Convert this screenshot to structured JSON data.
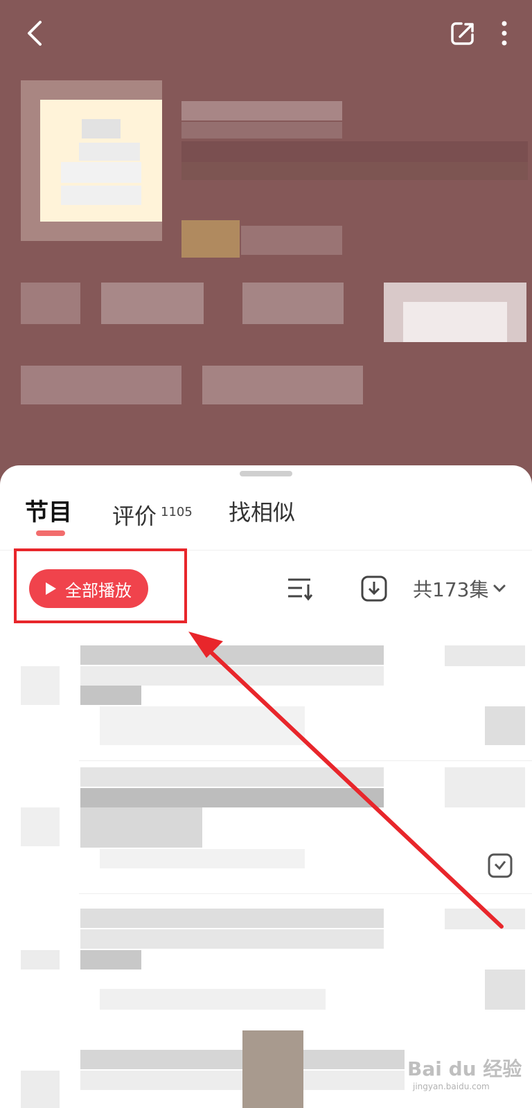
{
  "colors": {
    "header_bg": "#855858",
    "accent_red": "#f0434c",
    "tab_indicator": "#f26d6d",
    "highlight_border": "#e8262b"
  },
  "header": {
    "back_icon": "chevron-left-icon",
    "share_icon": "share-icon",
    "more_icon": "more-vertical-icon"
  },
  "tabs": [
    {
      "label": "节目",
      "active": true
    },
    {
      "label": "评价",
      "count": "1105"
    },
    {
      "label": "找相似"
    }
  ],
  "toolbar": {
    "play_all_label": "全部播放",
    "play_icon": "play-icon",
    "sort_icon": "sort-icon",
    "download_icon": "download-icon",
    "episode_count": "共173集",
    "expand_icon": "chevron-down-icon"
  },
  "watermark": {
    "main": "Bai du 经验",
    "sub": "jingyan.baidu.com"
  }
}
